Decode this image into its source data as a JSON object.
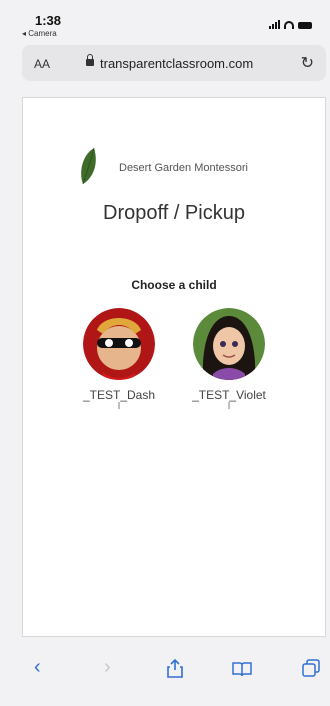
{
  "status": {
    "time": "1:38",
    "back_app": "◂ Camera"
  },
  "browser": {
    "aa_label": "AA",
    "url": "transparentclassroom.com",
    "reload_icon": "reload-icon"
  },
  "page": {
    "school_name": "Desert Garden Montessori",
    "title": "Dropoff / Pickup",
    "choose_label": "Choose a child",
    "children": [
      {
        "name": "_TEST_Dash",
        "sub": "I"
      },
      {
        "name": "_TEST_Violet",
        "sub": "I"
      }
    ]
  },
  "toolbar": {
    "back": "‹",
    "forward": "›",
    "share_icon": "share-icon",
    "bookmarks_icon": "book-icon",
    "tabs_icon": "tabs-icon"
  },
  "colors": {
    "accent": "#2f6fd6",
    "leaf": "#3f6b2a"
  }
}
